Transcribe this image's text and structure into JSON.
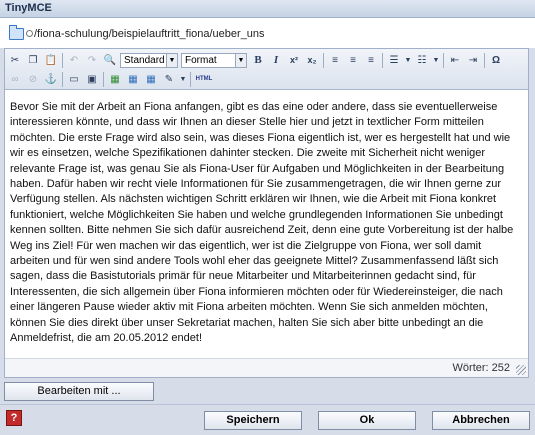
{
  "window": {
    "title": "TinyMCE"
  },
  "path": {
    "text": "/fiona-schulung/beispielauftritt_fiona/ueber_uns"
  },
  "toolbar": {
    "style_select": "Standard",
    "format_select": "Format",
    "bold_label": "B",
    "italic_label": "I",
    "superscript_label": "x²",
    "subscript_label": "x₂",
    "html_label": "HTML",
    "omega_label": "Ω"
  },
  "content": {
    "text": "Bevor Sie mit der Arbeit an Fiona anfangen, gibt es das eine oder andere, dass sie eventuellerweise interessieren könnte, und dass wir Ihnen an dieser Stelle hier und jetzt in textlicher Form mitteilen möchten. Die erste Frage wird also sein, was dieses Fiona eigentlich ist, wer es hergestellt hat und wie wir es einsetzen, welche Spezifikationen dahinter stecken. Die zweite mit Sicherheit nicht weniger relevante Frage ist, was genau Sie als Fiona-User für Aufgaben und Möglichkeiten in der Bearbeitung haben. Dafür haben wir recht viele Informationen für Sie zusammengetragen, die wir Ihnen gerne zur Verfügung stellen. Als nächsten wichtigen Schritt erklären wir Ihnen, wie die Arbeit mit Fiona konkret funktioniert, welche Möglichkeiten Sie haben und welche grundlegenden Informationen Sie unbedingt kennen sollten. Bitte nehmen Sie sich dafür ausreichend Zeit, denn eine gute Vorbereitung ist der halbe Weg ins Ziel! Für wen machen wir das eigentlich, wer ist die Zielgruppe von Fiona, wer soll damit arbeiten und für wen sind andere Tools wohl eher das geeignete Mittel? Zusammenfassend läßt sich sagen, dass die Basistutorials primär für neue Mitarbeiter und Mitarbeiterinnen gedacht sind, für Interessenten, die sich allgemein über Fiona informieren möchten oder für Wiedereinsteiger, die nach einer längeren Pause wieder aktiv mit Fiona arbeiten möchten. Wenn Sie sich anmelden möchten, können Sie dies direkt über unser Sekretariat machen, halten Sie sich aber bitte unbedingt an die Anmeldefrist, die am 20.05.2012 endet!"
  },
  "status": {
    "word_count": "Wörter: 252"
  },
  "buttons": {
    "edit_with": "Bearbeiten mit ...",
    "save": "Speichern",
    "ok": "Ok",
    "cancel": "Abbrechen",
    "help_label": "?"
  }
}
